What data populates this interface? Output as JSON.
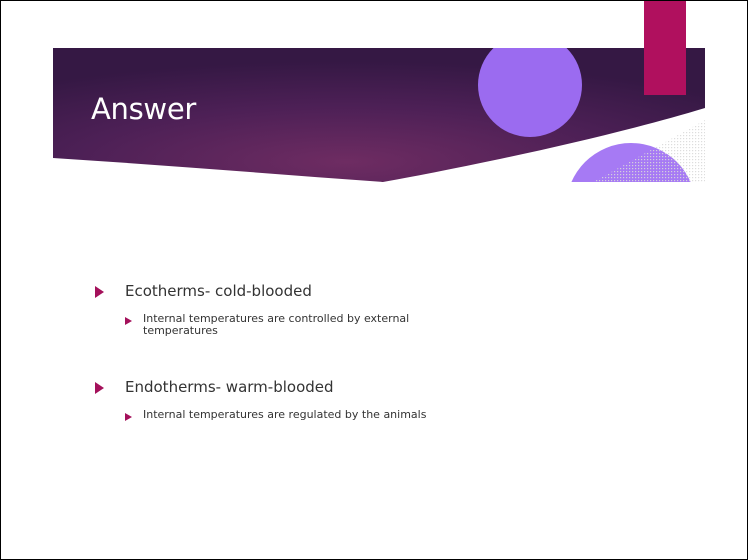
{
  "slide": {
    "title": "Answer",
    "colors": {
      "banner_dark": "#3a1846",
      "banner_mid": "#6a2a5e",
      "circle_purple": "#9b6bf0",
      "accent_magenta": "#b0105e",
      "bullet_arrow": "#a4115b",
      "text": "#333333"
    },
    "bullets": [
      {
        "text": "Ecotherms- cold-blooded",
        "sub": [
          "Internal temperatures are controlled by external temperatures"
        ]
      },
      {
        "text": "Endotherms- warm-blooded",
        "sub": [
          "Internal temperatures are regulated by the animals"
        ]
      }
    ]
  }
}
